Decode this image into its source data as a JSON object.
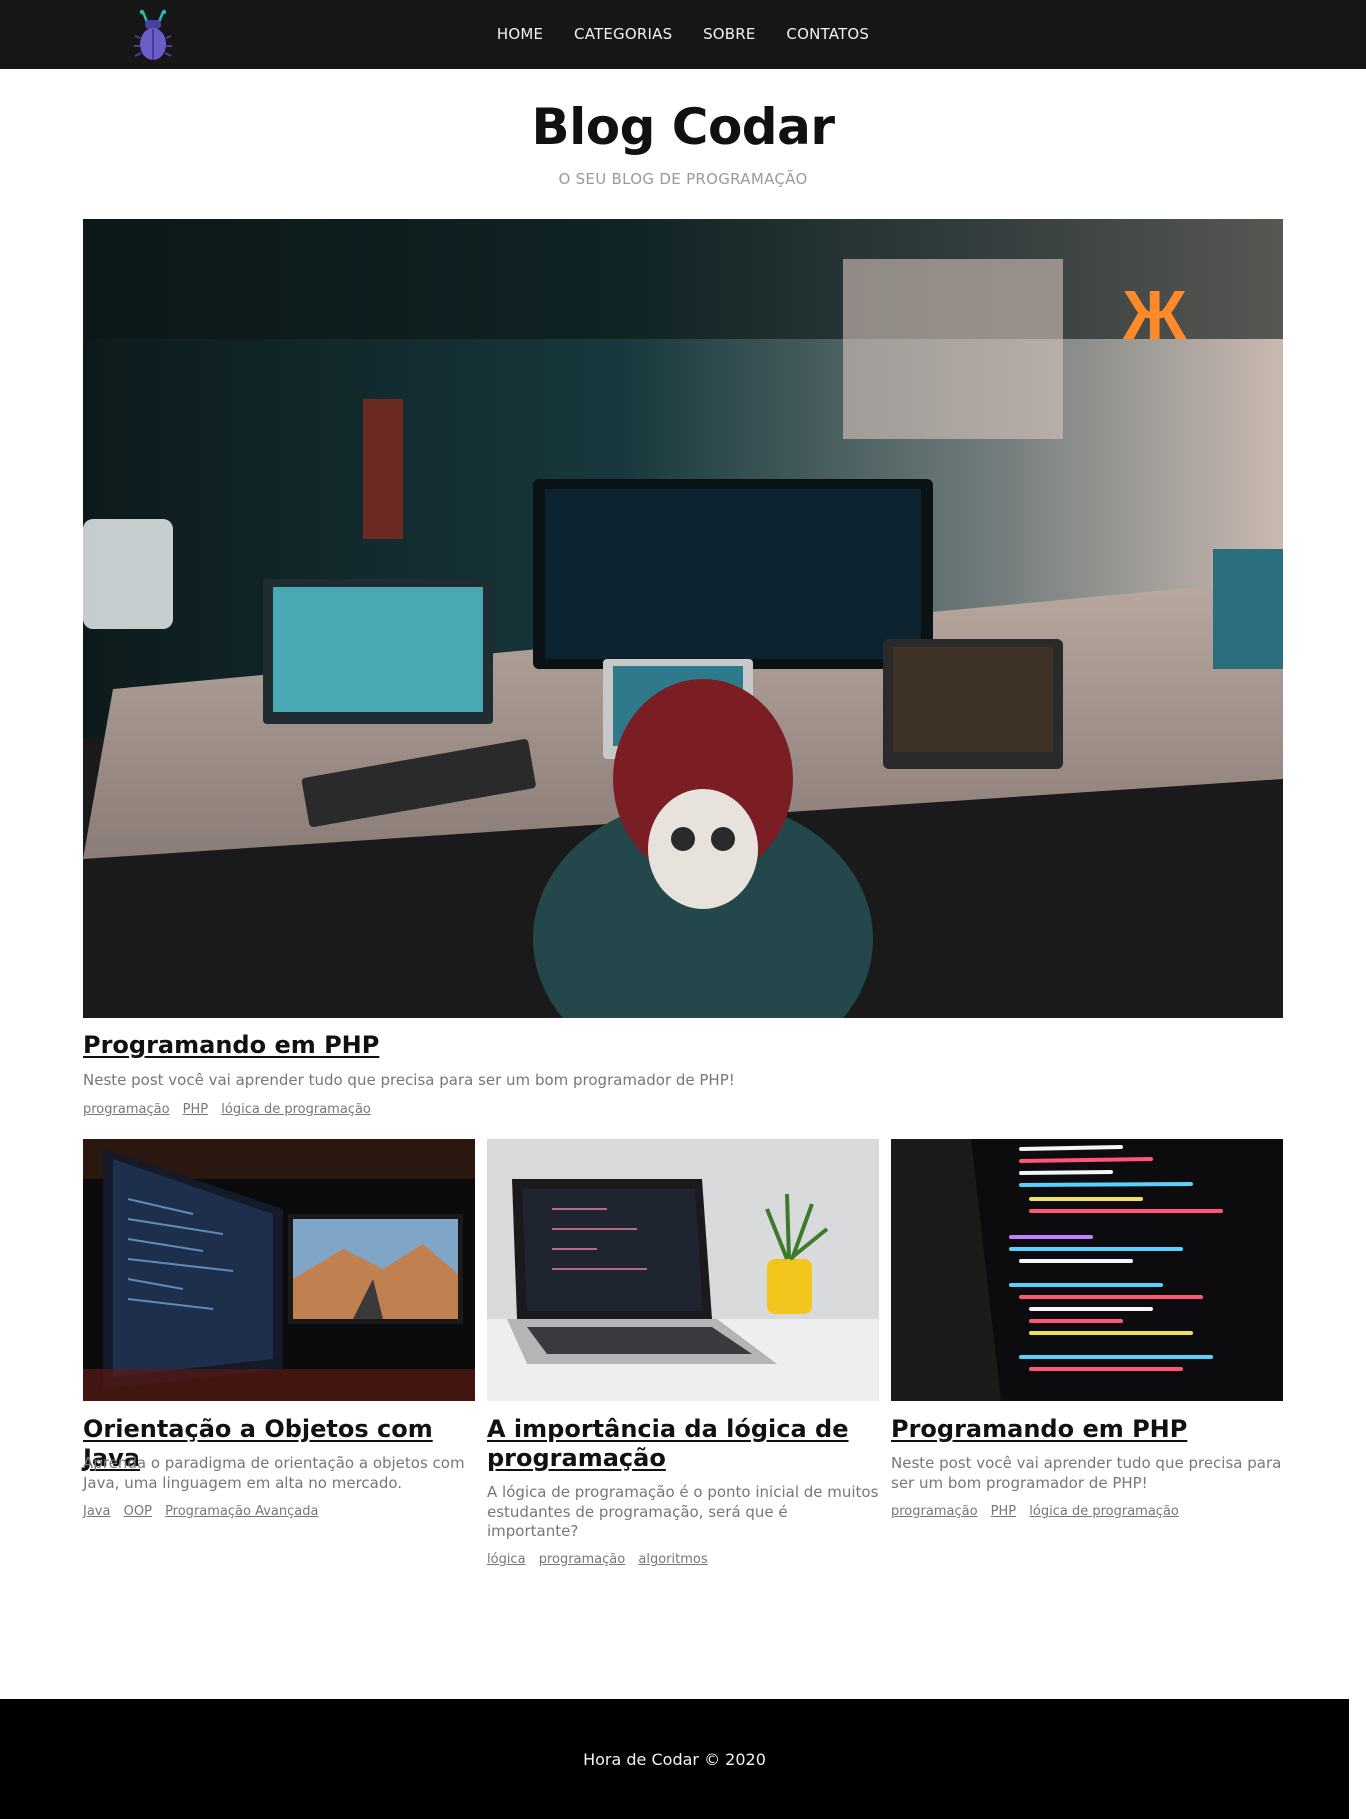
{
  "nav": {
    "logo_icon": "bug-icon",
    "items": [
      "HOME",
      "CATEGORIAS",
      "SOBRE",
      "CONTATOS"
    ]
  },
  "header": {
    "title": "Blog Codar",
    "subtitle": "O SEU BLOG DE PROGRAMAÇÃO"
  },
  "featured": {
    "title": "Programando em PHP",
    "excerpt": "Neste post você vai aprender tudo que precisa para ser um bom programador de PHP!",
    "tags": [
      "programação",
      "PHP",
      "lógica de programação"
    ]
  },
  "posts": [
    {
      "title": "Orientação a Objetos com Java",
      "excerpt": "Aprenda o paradigma de orientação a objetos com Java, uma linguagem em alta no mercado.",
      "tags": [
        "Java",
        "OOP",
        "Programação Avançada"
      ]
    },
    {
      "title": "A importância da lógica de programação",
      "excerpt": "A lógica de programação é o ponto inicial de muitos estudantes de programação, será que é importante?",
      "tags": [
        "lógica",
        "programação",
        "algoritmos"
      ]
    },
    {
      "title": "Programando em PHP",
      "excerpt": "Neste post você vai aprender tudo que precisa para ser um bom programador de PHP!",
      "tags": [
        "programação",
        "PHP",
        "lógica de programação"
      ]
    }
  ],
  "footer": {
    "text": "Hora de Codar © 2020"
  }
}
